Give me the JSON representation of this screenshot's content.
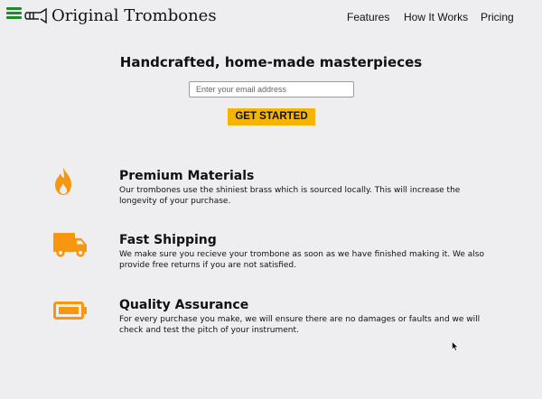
{
  "header": {
    "brand": "Original Trombones",
    "nav": [
      "Features",
      "How It Works",
      "Pricing"
    ]
  },
  "hero": {
    "title": "Handcrafted, home-made masterpieces",
    "email_placeholder": "Enter your email address",
    "cta_label": "GET STARTED"
  },
  "features": [
    {
      "icon": "fire-icon",
      "title": "Premium Materials",
      "description": "Our trombones use the shiniest brass which is sourced locally. This will increase the longevity of your purchase."
    },
    {
      "icon": "truck-icon",
      "title": "Fast Shipping",
      "description": "We make sure you recieve your trombone as soon as we have finished making it. We also provide free returns if you are not satisfied."
    },
    {
      "icon": "battery-icon",
      "title": "Quality Assurance",
      "description": "For every purchase you make, we will ensure there are no damages or faults and we will check and test the pitch of your instrument."
    }
  ],
  "colors": {
    "accent": "#f4b400",
    "icon": "#f7960f",
    "menu": "#1e8a2a",
    "background": "#eeeef0"
  }
}
